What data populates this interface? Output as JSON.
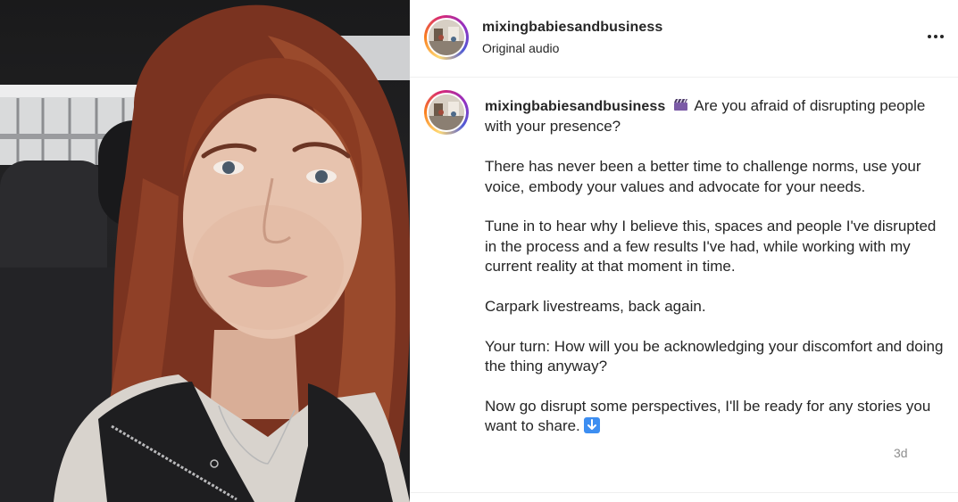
{
  "media": {
    "description_icon": "selfie-photo",
    "palette": {
      "hair": "#8a3b22",
      "skin": "#e7c3ae",
      "vest": "#1e1e20",
      "car_interior": "#232325"
    }
  },
  "header": {
    "username": "mixingbabiesandbusiness",
    "audio": "Original audio",
    "more_icon": "more-horizontal-icon"
  },
  "caption": {
    "username": "mixingbabiesandbusiness",
    "emoji_first": "clapper-board-icon",
    "paragraphs": [
      "Are you afraid of disrupting people with your presence?",
      "There has never been a better time to challenge norms, use your voice, embody your values and advocate for your needs.",
      "Tune in to hear why I believe this, spaces and people I've disrupted in the process and a few results I've had, while working with my current reality at that moment in time.",
      "Carpark livestreams, back again.",
      "Your turn: How will you be acknowledging your discomfort and doing the thing anyway?",
      "Now go disrupt some perspectives, I'll be ready for any stories you want to share."
    ],
    "emoji_last": "down-arrow-icon"
  },
  "timestamp": "3d",
  "colors": {
    "text": "#262626",
    "muted": "#8e8e8e",
    "divider": "#efefef"
  }
}
